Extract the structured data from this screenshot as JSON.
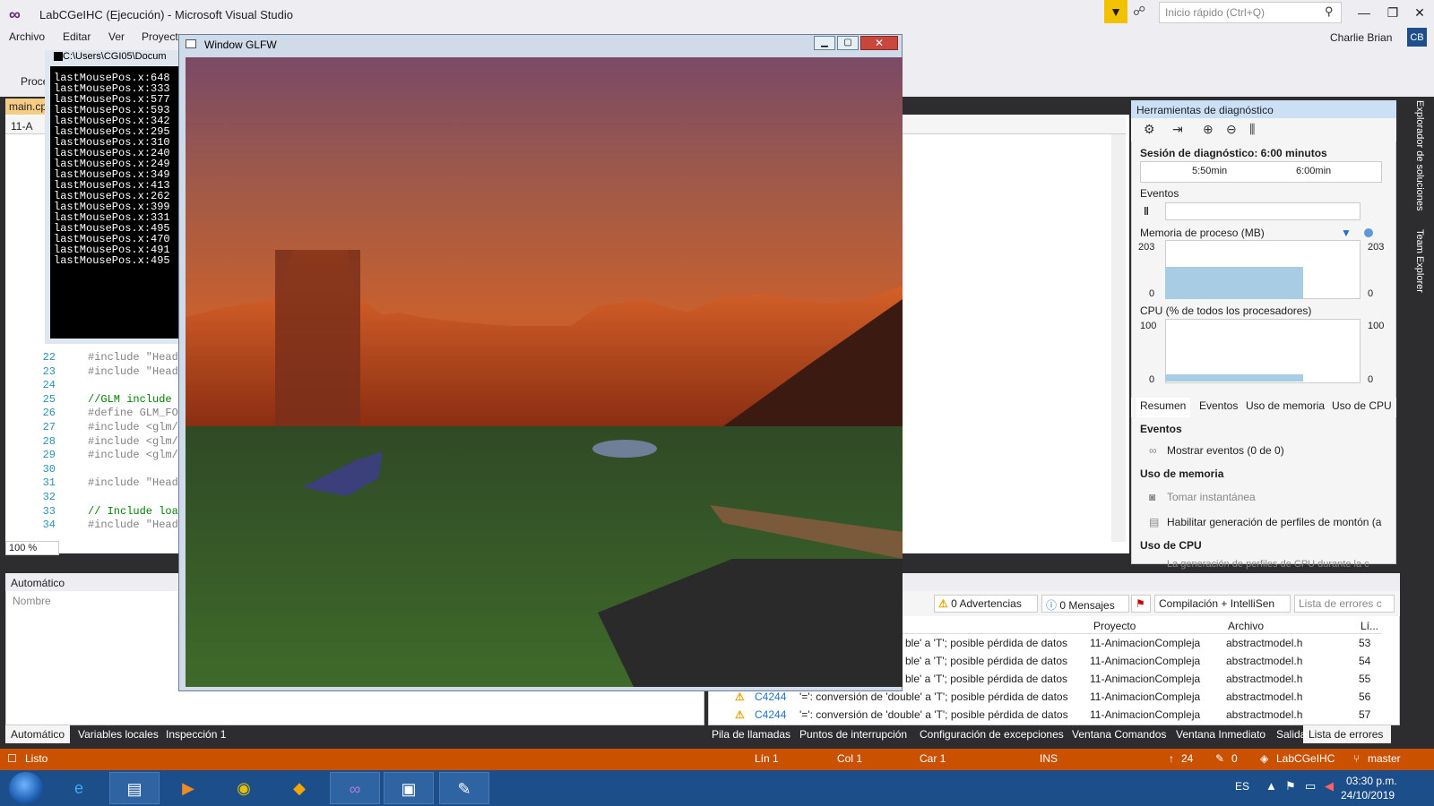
{
  "vs": {
    "title": "LabCGeIHC (Ejecución) - Microsoft Visual Studio",
    "quick_launch_placeholder": "Inicio rápido (Ctrl+Q)",
    "menu": [
      "Archivo",
      "Editar",
      "Ver",
      "Proyecto"
    ],
    "user": "Charlie Brian",
    "user_initials": "CB",
    "toolbar_process": "Proce",
    "editor_tab": "main.cp",
    "nav_bar": "11-A",
    "zoom": "100 %",
    "brand_color": "#68217a",
    "status_color": "#ca5100"
  },
  "code": {
    "lines": [
      {
        "n": "22",
        "text": "#include \"Heade",
        "kind": "pp"
      },
      {
        "n": "23",
        "text": "#include \"Heade",
        "kind": "pp"
      },
      {
        "n": "24",
        "text": "",
        "kind": "pp"
      },
      {
        "n": "25",
        "text": "//GLM include",
        "kind": "cm"
      },
      {
        "n": "26",
        "text": "#define GLM_FOR",
        "kind": "pp"
      },
      {
        "n": "27",
        "text": "#include <glm/g",
        "kind": "pp"
      },
      {
        "n": "28",
        "text": "#include <glm/g",
        "kind": "pp"
      },
      {
        "n": "29",
        "text": "#include <glm/g",
        "kind": "pp"
      },
      {
        "n": "30",
        "text": "",
        "kind": "pp"
      },
      {
        "n": "31",
        "text": "#include \"Heade",
        "kind": "pp"
      },
      {
        "n": "32",
        "text": "",
        "kind": "pp"
      },
      {
        "n": "33",
        "text": "// Include load",
        "kind": "cm"
      },
      {
        "n": "34",
        "text": "#include \"Heade",
        "kind": "pp"
      }
    ]
  },
  "console": {
    "title": "C:\\Users\\CGI05\\Docum",
    "lines": [
      "lastMousePos.x:648",
      "lastMousePos.x:333",
      "lastMousePos.x:577",
      "lastMousePos.x:593",
      "lastMousePos.x:342",
      "lastMousePos.x:295",
      "lastMousePos.x:310",
      "lastMousePos.x:240",
      "lastMousePos.x:249",
      "lastMousePos.x:349",
      "lastMousePos.x:413",
      "lastMousePos.x:262",
      "lastMousePos.x:399",
      "lastMousePos.x:331",
      "lastMousePos.x:495",
      "lastMousePos.x:470",
      "lastMousePos.x:491",
      "lastMousePos.x:495"
    ]
  },
  "glfw": {
    "title": "Window GLFW"
  },
  "diagnostics": {
    "title": "Herramientas de diagnóstico",
    "session": "Sesión de diagnóstico: 6:00 minutos",
    "timeline_ticks": [
      "5:50min",
      "6:00min"
    ],
    "events_label": "Eventos",
    "memory_label": "Memoria de proceso (MB)",
    "memory_max": "203",
    "memory_min": "0",
    "memory_level": 0.55,
    "cpu_label": "CPU (% de todos los procesadores)",
    "cpu_max": "100",
    "cpu_min": "0",
    "tabs": [
      "Resumen",
      "Eventos",
      "Uso de memoria",
      "Uso de CPU"
    ],
    "sec_events": "Eventos",
    "show_events": "Mostrar eventos (0 de 0)",
    "sec_memory": "Uso de memoria",
    "take_snapshot": "Tomar instantánea",
    "heap_profiling": "Habilitar generación de perfiles de montón (a",
    "sec_cpu": "Uso de CPU",
    "cpu_note": "La generación de perfiles de CPU durante la c"
  },
  "right_tabs": [
    "Explorador de soluciones",
    "Team Explorer"
  ],
  "autos": {
    "title": "Automático",
    "column": "Nombre",
    "tabs": [
      "Automático",
      "Variables locales",
      "Inspección 1"
    ]
  },
  "errors": {
    "warnings": "0 Advertencias",
    "messages": "0 Mensajes",
    "filter": "Compilación + IntelliSen",
    "search_placeholder": "Lista de errores c",
    "columns": [
      "Proyecto",
      "Archivo",
      "Lí..."
    ],
    "rows": [
      {
        "code": "",
        "desc": "ble' a 'T'; posible pérdida de datos",
        "project": "11-AnimacionCompleja",
        "file": "abstractmodel.h",
        "line": "53"
      },
      {
        "code": "",
        "desc": "ble' a 'T'; posible pérdida de datos",
        "project": "11-AnimacionCompleja",
        "file": "abstractmodel.h",
        "line": "54"
      },
      {
        "code": "",
        "desc": "ble' a 'T'; posible pérdida de datos",
        "project": "11-AnimacionCompleja",
        "file": "abstractmodel.h",
        "line": "55"
      },
      {
        "code": "C4244",
        "desc": "'=': conversión de 'double' a 'T'; posible pérdida de datos",
        "project": "11-AnimacionCompleja",
        "file": "abstractmodel.h",
        "line": "56"
      },
      {
        "code": "C4244",
        "desc": "'=': conversión de 'double' a 'T'; posible pérdida de datos",
        "project": "11-AnimacionCompleja",
        "file": "abstractmodel.h",
        "line": "57"
      }
    ],
    "tabs": [
      "Pila de llamadas",
      "Puntos de interrupción",
      "Configuración de excepciones",
      "Ventana Comandos",
      "Ventana Inmediato",
      "Salida",
      "Lista de errores"
    ]
  },
  "status": {
    "ready": "Listo",
    "line": "Lín 1",
    "col": "Col 1",
    "car": "Car 1",
    "ins": "INS",
    "push": "24",
    "edits": "0",
    "repo": "LabCGeIHC",
    "branch": "master"
  },
  "taskbar": {
    "lang": "ES",
    "time": "03:30 p.m.",
    "date": "24/10/2019",
    "bg": "#1c4e8a"
  }
}
